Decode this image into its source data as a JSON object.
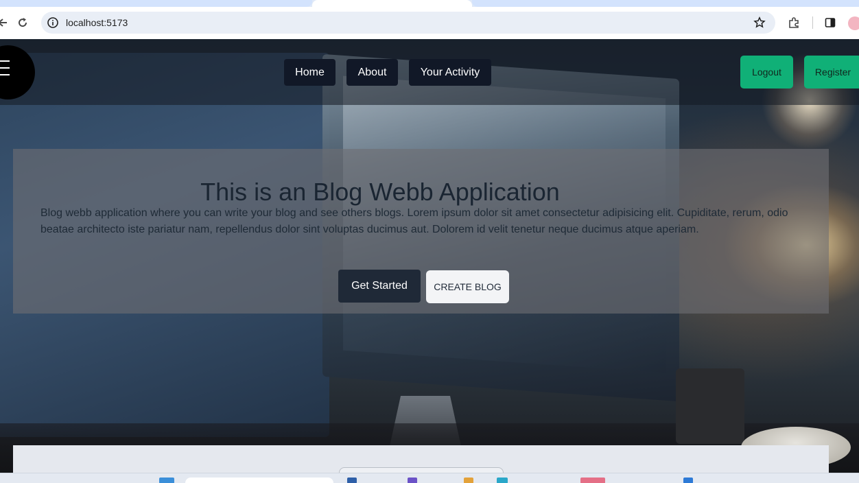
{
  "browser": {
    "url": "localhost:5173",
    "icons": [
      "back-icon",
      "reload-icon",
      "info-icon",
      "bookmark-star-icon",
      "extensions-icon",
      "side-panel-icon",
      "profile-avatar"
    ]
  },
  "header": {
    "nav": [
      "Home",
      "About",
      "Your Activity"
    ],
    "auth": {
      "logout": "Logout",
      "register": "Register"
    }
  },
  "hero": {
    "title": "This is an Blog Webb Application",
    "description": "Blog webb application where you can write your blog and see others blogs. Lorem ipsum dolor sit amet consectetur adipisicing elit. Cupiditate, rerum, odio beatae architecto iste pariatur nam, repellendus dolor sint voluptas ducimus aut. Dolorem id velit tenetur neque ducimus atque aperiam.",
    "get_started": "Get Started",
    "create_blog": "CREATE BLOG"
  },
  "colors": {
    "nav_bg": "#111827",
    "auth_bg": "#10b077",
    "start_bg": "#1f2937",
    "create_bg": "#f3f4f6"
  }
}
